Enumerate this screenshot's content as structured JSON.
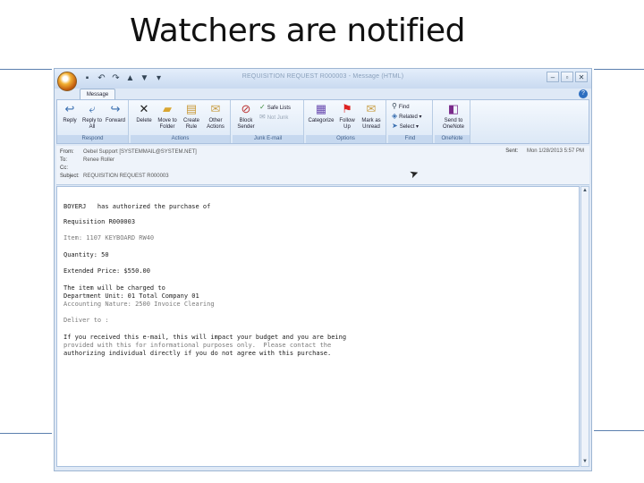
{
  "slide": {
    "title": "Watchers are notified"
  },
  "window": {
    "title": "REQUISITION REQUEST R000003 - Message (HTML)",
    "tab": "Message"
  },
  "ribbon": {
    "respond": {
      "label": "Respond",
      "reply": "Reply",
      "reply_all": "Reply to All",
      "forward": "Forward"
    },
    "actions": {
      "label": "Actions",
      "delete": "Delete",
      "move": "Move to Folder",
      "create_rule": "Create Rule",
      "other": "Other Actions"
    },
    "junk": {
      "label": "Junk E-mail",
      "block": "Block Sender",
      "safe_lists": "Safe Lists",
      "not_junk": "Not Junk"
    },
    "options": {
      "label": "Options",
      "categorize": "Categorize",
      "follow_up": "Follow Up",
      "mark_unread": "Mark as Unread"
    },
    "find": {
      "label": "Find",
      "find": "Find",
      "related": "Related",
      "select": "Select"
    },
    "onenote": {
      "label": "OneNote",
      "send": "Send to OneNote"
    }
  },
  "headers": {
    "from_label": "From:",
    "from_value": "Oebel Support [SYSTEMMAIL@SYSTEM.NET]",
    "to_label": "To:",
    "to_value": "Renee Roller",
    "cc_label": "Cc:",
    "cc_value": "",
    "subject_label": "Subject:",
    "subject_value": "REQUISITION REQUEST R000003",
    "sent_label": "Sent:",
    "sent_value": "Mon 1/28/2013 5:57 PM"
  },
  "body": {
    "l1": "BOYERJ   has authorized the purchase of",
    "l2": "Requisition R000003",
    "l3": "Item: 1107 KEYBOARD RW40",
    "l4": "Quantity: 50",
    "l5": "Extended Price: $550.00",
    "l6": "The item will be charged to",
    "l7": "Department Unit: 01 Total Company 01",
    "l8": "Accounting Nature: 2500 Invoice Clearing",
    "l9": "Deliver to :",
    "l10": "If you received this e-mail, this will impact your budget and you are being",
    "l11": "provided with this for informational purposes only.  Please contact the",
    "l12": "authorizing individual directly if you do not agree with this purchase."
  }
}
